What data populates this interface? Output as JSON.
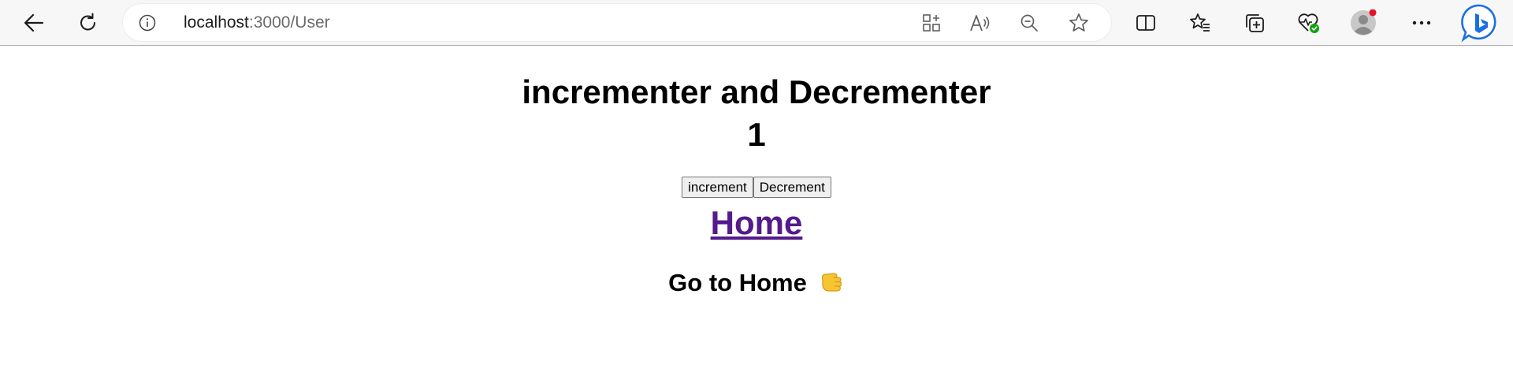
{
  "browser": {
    "url_host": "localhost",
    "url_path": ":3000/User",
    "icons": {
      "back": "back-arrow-icon",
      "refresh": "refresh-icon",
      "info": "info-icon",
      "apps": "apps-icon",
      "read_aloud": "read-aloud-icon",
      "zoom_out": "zoom-out-icon",
      "favorite": "star-icon",
      "split_screen": "split-screen-icon",
      "favorites": "favorites-icon",
      "collections": "collections-icon",
      "health": "browser-essentials-icon",
      "profile": "profile-avatar",
      "more": "more-icon",
      "copilot": "bing-copilot-icon"
    },
    "accent": "#0078d4",
    "notification_color": "#e81123"
  },
  "page": {
    "title": "incrementer and Decrementer",
    "counter": "1",
    "increment_label": "increment",
    "decrement_label": "Decrement",
    "home_link": "Home",
    "goto_text": "Go to Home",
    "goto_emoji": "pointing-hand-icon",
    "link_color": "#551a8b"
  }
}
